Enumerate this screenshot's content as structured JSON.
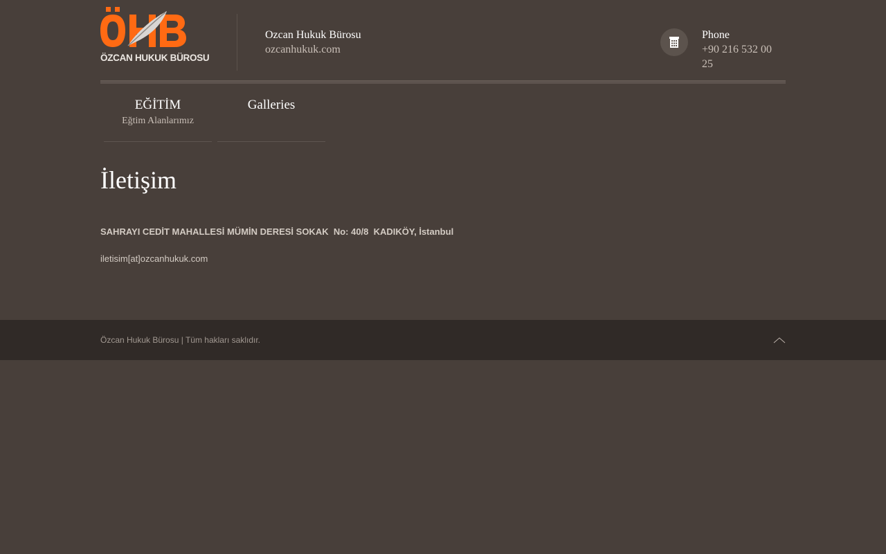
{
  "header": {
    "logo_text": "ÖZCAN HUKUK BÜROSU",
    "site_name": "Ozcan Hukuk Bürosu",
    "site_url": "ozcanhukuk.com",
    "phone_label": "Phone",
    "phone_number": "+90 216 532 00 25",
    "phone_icon": "phone-icon"
  },
  "nav": {
    "items": [
      {
        "title": "EĞİTİM",
        "subtitle": "Eğtim Alanlarımız"
      },
      {
        "title": "Galleries",
        "subtitle": ""
      }
    ]
  },
  "content": {
    "title": "İletişim",
    "address": "SAHRAYI CEDİT MAHALLESİ MÜMİN DERESİ SOKAK  No: 40/8  KADIKÖY, İstanbul",
    "email": "iletisim[at]ozcanhukuk.com"
  },
  "footer": {
    "copyright": "Özcan Hukuk Bürosu | Tüm hakları saklıdır.",
    "top_icon": "chevron-up-icon"
  },
  "colors": {
    "background": "#483f3a",
    "footer": "#302a27",
    "brand_orange": "#ff6a13"
  }
}
